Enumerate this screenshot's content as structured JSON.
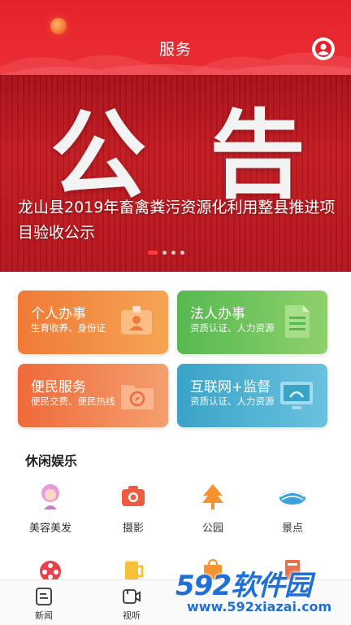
{
  "header": {
    "title": "服务",
    "user_icon": "user-circle-icon",
    "background": "#e4222b"
  },
  "banner": {
    "big_chars": [
      "公",
      "告"
    ],
    "caption": "龙山县2019年畜禽粪污资源化利用整县推进项目验收公示",
    "page_count": 4,
    "active_page": 1
  },
  "services": [
    {
      "title": "个人办事",
      "subtitle": "生育收养、身份证",
      "icon": "id-card-icon",
      "color": "#f07a37"
    },
    {
      "title": "法人办事",
      "subtitle": "资质认证、人力资源",
      "icon": "document-icon",
      "color": "#56b950"
    },
    {
      "title": "便民服务",
      "subtitle": "便民交费、便民热线",
      "icon": "folder-compass-icon",
      "color": "#ef6a3a"
    },
    {
      "title": "互联网+监督",
      "subtitle": "资质认证、人力资源",
      "icon": "monitor-icon",
      "color": "#3aa3c8"
    }
  ],
  "leisure": {
    "title": "休闲娱乐",
    "items": [
      {
        "label": "美容美发",
        "icon": "beauty-icon"
      },
      {
        "label": "摄影",
        "icon": "camera-icon"
      },
      {
        "label": "公园",
        "icon": "tree-icon"
      },
      {
        "label": "景点",
        "icon": "scenic-icon"
      }
    ]
  },
  "bottom_nav": [
    {
      "label": "新闻",
      "icon": "news-icon"
    },
    {
      "label": "视听",
      "icon": "video-icon"
    }
  ],
  "watermark": {
    "brand": "592软件园",
    "url": "www.592xiazai.com"
  }
}
